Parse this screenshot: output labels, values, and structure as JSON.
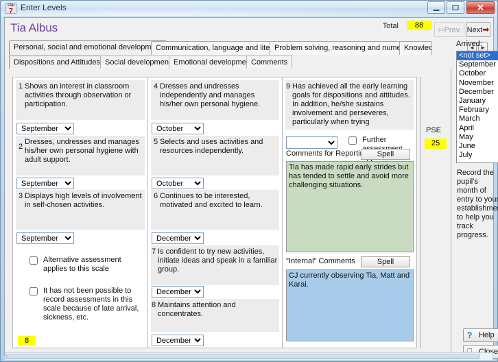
{
  "window": {
    "title": "Enter Levels",
    "app_icon": "app-icon",
    "minimize": "minimize-icon",
    "maximize": "maximize-icon",
    "close": "✕"
  },
  "header": {
    "pupil_name": "Tia Albus",
    "total_label": "Total",
    "total_value": "88",
    "prev_label": "Prev.",
    "next_label": "Next",
    "prev_arrow": "⇦",
    "next_arrow": "➡"
  },
  "area_tabs": [
    {
      "label": "Personal, social and emotional development",
      "active": true
    },
    {
      "label": "Communication, language and literacy",
      "active": false
    },
    {
      "label": "Problem solving, reasoning and numeracy",
      "active": false
    },
    {
      "label": "Knowled",
      "active": false
    }
  ],
  "tab_scroll": {
    "left": "◄",
    "right": "►"
  },
  "sub_tabs": [
    {
      "label": "Dispositions and Attitudes",
      "active": true
    },
    {
      "label": "Social development",
      "active": false
    },
    {
      "label": "Emotional development",
      "active": false
    },
    {
      "label": "Comments",
      "active": false
    }
  ],
  "scales": [
    {
      "num": "1",
      "text": "Shows an interest in classroom activities through observation or participation.",
      "month": "September"
    },
    {
      "num": "2",
      "text": "Dresses, undresses and manages his/her own personal hygiene with adult support.",
      "month": "September"
    },
    {
      "num": "3",
      "text": "Displays high levels of involvement in self-chosen activities.",
      "month": "September"
    },
    {
      "num": "4",
      "text": "Dresses and undresses independently and manages his/her own personal hygiene.",
      "month": "October"
    },
    {
      "num": "5",
      "text": "Selects and uses activities and resources independently.",
      "month": "October"
    },
    {
      "num": "6",
      "text": "Continues to be interested, motivated and excited to learn.",
      "month": "December"
    },
    {
      "num": "7",
      "text": "Is confident to try new activities, initiate ideas and speak in a familiar group.",
      "month": "December"
    },
    {
      "num": "8",
      "text": "Maintains attention and concentrates.",
      "month": "December"
    },
    {
      "num": "9",
      "text": "Has achieved all the early learning goals for dispositions and attitudes.  In addition, he/she sustains involvement and perseveres, particularly when trying",
      "month": ""
    }
  ],
  "checkboxes": [
    {
      "label": "Alternative assessment applies to this scale",
      "checked": false
    },
    {
      "label": "It has not been possible to record assessments in this scale because of late arrival, sickness, etc.",
      "checked": false
    }
  ],
  "goal_select": {
    "value": "",
    "options": [
      "",
      "September",
      "October",
      "November",
      "December",
      "January",
      "February",
      "March",
      "April",
      "May",
      "June",
      "July"
    ]
  },
  "further_assessment": {
    "label": "Further assessment applies",
    "checked": false
  },
  "comments": {
    "reporting_label": "Comments for Reporting",
    "reporting_spell": "Spell",
    "reporting_text": "Tia has made rapid early strides but has tended to settle and avoid more challenging situations.",
    "internal_label": "\"Internal\" Comments",
    "internal_spell": "Spell",
    "internal_text": "CJ currently observing Tia, Matt and Karai."
  },
  "pse": {
    "label": "PSE",
    "value": "25"
  },
  "subtotal": "8",
  "arrived": {
    "label": "Arrived:",
    "selected": "<not set>",
    "options": [
      "<not set>",
      "September",
      "October",
      "November",
      "December",
      "January",
      "February",
      "March",
      "April",
      "May",
      "June",
      "July"
    ]
  },
  "hint": "Record the pupil's month of entry to your establishment to help you track progress.",
  "buttons": {
    "help_label": "Help",
    "help_glyph": "?",
    "close_label": "Close",
    "close_glyph": "⎕"
  },
  "month_options": [
    "",
    "September",
    "October",
    "November",
    "December",
    "January",
    "February",
    "March",
    "April",
    "May",
    "June",
    "July"
  ],
  "colors": {
    "highlight_yellow": "#ffff00",
    "name_purple": "#6b3fa0",
    "reporting_green": "#c9dcc2",
    "internal_blue": "#a8cbea",
    "selection_blue": "#2d6fd0",
    "close_red": "#c3352a"
  }
}
